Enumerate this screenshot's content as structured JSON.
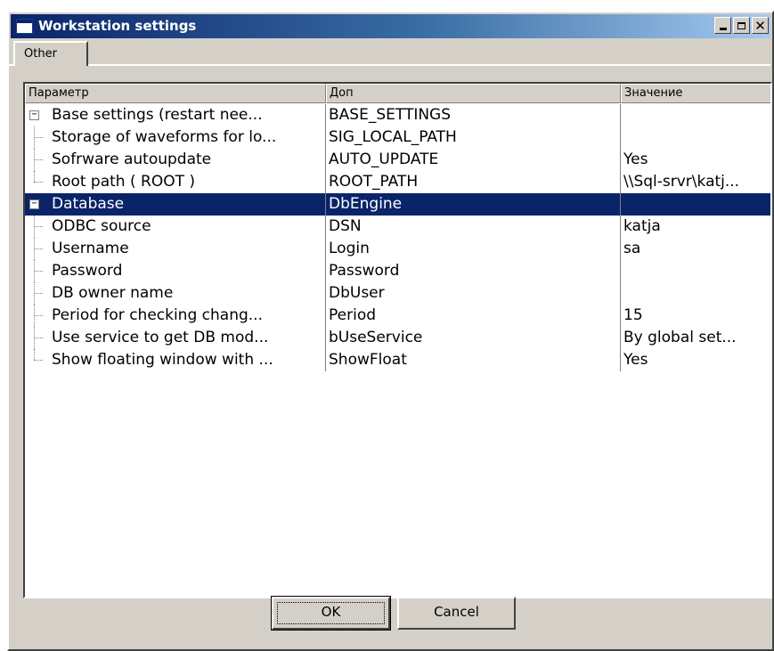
{
  "window": {
    "title": "Workstation settings",
    "controls": {
      "minimize": "minimize",
      "maximize": "maximize",
      "close": "✕"
    }
  },
  "tabs": [
    {
      "label": "Other"
    }
  ],
  "grid": {
    "columns": [
      "Параметр",
      "Доп",
      "Значение"
    ],
    "rows": [
      {
        "param": "Base settings (restart nee...",
        "key": "BASE_SETTINGS",
        "value": "",
        "expander": "−"
      },
      {
        "param": "Storage of waveforms for lo...",
        "key": "SIG_LOCAL_PATH",
        "value": ""
      },
      {
        "param": "Sofrware autoupdate",
        "key": "AUTO_UPDATE",
        "value": "Yes"
      },
      {
        "param": "Root path ( ROOT )",
        "key": "ROOT_PATH",
        "value": "\\\\Sql-srvr\\katj..."
      },
      {
        "param": "Database",
        "key": "DbEngine",
        "value": "",
        "expander": "−",
        "selected": true
      },
      {
        "param": "ODBC source",
        "key": "DSN",
        "value": "katja"
      },
      {
        "param": "Username",
        "key": "Login",
        "value": "sa"
      },
      {
        "param": "Password",
        "key": "Password",
        "value": ""
      },
      {
        "param": "DB owner name",
        "key": "DbUser",
        "value": ""
      },
      {
        "param": "Period for checking chang...",
        "key": "Period",
        "value": "15"
      },
      {
        "param": "Use service to get DB mod...",
        "key": "bUseService",
        "value": "By global set..."
      },
      {
        "param": "Show floating window with ...",
        "key": "ShowFloat",
        "value": "Yes"
      }
    ]
  },
  "buttons": {
    "ok": "OK",
    "cancel": "Cancel"
  },
  "colors": {
    "title_start": "#0a246a",
    "title_end": "#a6caf0",
    "selection": "#0a246a",
    "face": "#d4d0c8"
  }
}
